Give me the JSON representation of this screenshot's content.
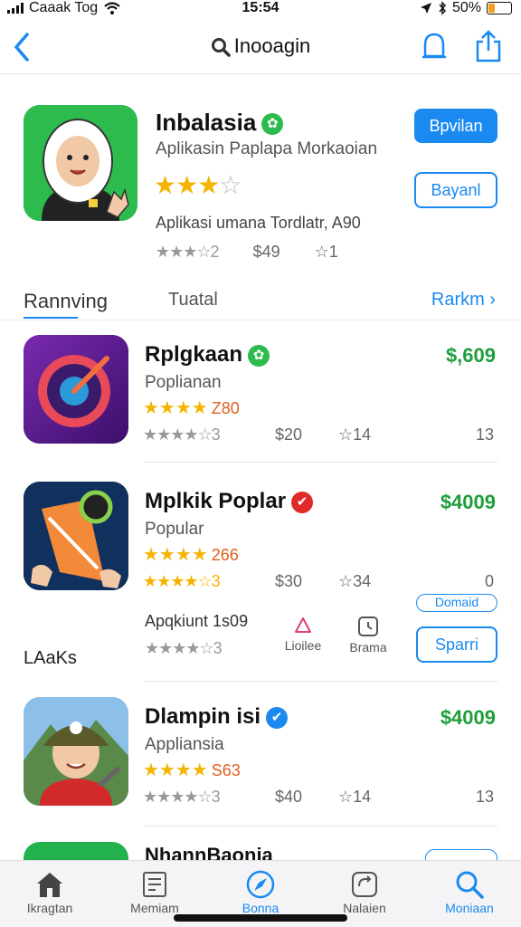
{
  "status_bar": {
    "carrier": "Caaak Tog",
    "time": "15:54",
    "battery": "50%",
    "battery_level": 0.3
  },
  "nav": {
    "title": "Inooagin",
    "back_icon": "chevron-left-icon",
    "bell_icon": "bell-icon",
    "share_icon": "share-icon"
  },
  "featured": {
    "title": "Inbalasia",
    "subtitle": "Aplikasin Paplapa Morkaoian",
    "stars": "★★★☆",
    "description": "Aplikasi umana Tordlatr, A90",
    "meta": [
      "★★★☆2",
      "$49",
      "☆1"
    ],
    "primary_button": "Bpvilan",
    "secondary_button": "Bayanl"
  },
  "tabs": {
    "tab1": "Rannving",
    "tab2": "Tuatal",
    "more": "Rarkm ›"
  },
  "rows": [
    {
      "name": "Rplgkaan",
      "category": "Poplianan",
      "price": "$,609",
      "stars": "★★★★",
      "count": "Z80",
      "meta_stars": "★★★★☆3",
      "meta_price": "$20",
      "meta_rank": "☆14",
      "meta_num": "13"
    },
    {
      "name": "Mplkik Poplar",
      "category": "Popular",
      "price": "$4009",
      "stars": "★★★★",
      "count": "266",
      "meta_stars": "★★★★☆3",
      "meta_price": "$30",
      "meta_rank": "☆34",
      "meta_num": "0"
    },
    {
      "name": "Dlampin isi",
      "category": "Appliansia",
      "price": "$4009",
      "stars": "★★★★",
      "count": "S63",
      "meta_stars": "★★★★☆3",
      "meta_price": "$40",
      "meta_rank": "☆14",
      "meta_num": "13"
    }
  ],
  "section_label": "LAaKs",
  "extra": {
    "label": "Apqkiunt 1s09",
    "stars": "★★★★☆3",
    "mini1": "Lioilee",
    "mini2": "Brama",
    "chip": "Domaid",
    "button": "Sparri"
  },
  "partial_row": {
    "name": "NhannBaonia"
  },
  "tabbar": [
    {
      "label": "Ikragtan",
      "icon": "home-icon"
    },
    {
      "label": "Memiam",
      "icon": "news-icon"
    },
    {
      "label": "Bonna",
      "icon": "compass-icon"
    },
    {
      "label": "Nalaien",
      "icon": "refresh-box-icon"
    },
    {
      "label": "Moniaan",
      "icon": "search-icon"
    }
  ],
  "colors": {
    "accent": "#1a8af0",
    "price_green": "#1e9e3a",
    "star_gold": "#f5b400"
  }
}
